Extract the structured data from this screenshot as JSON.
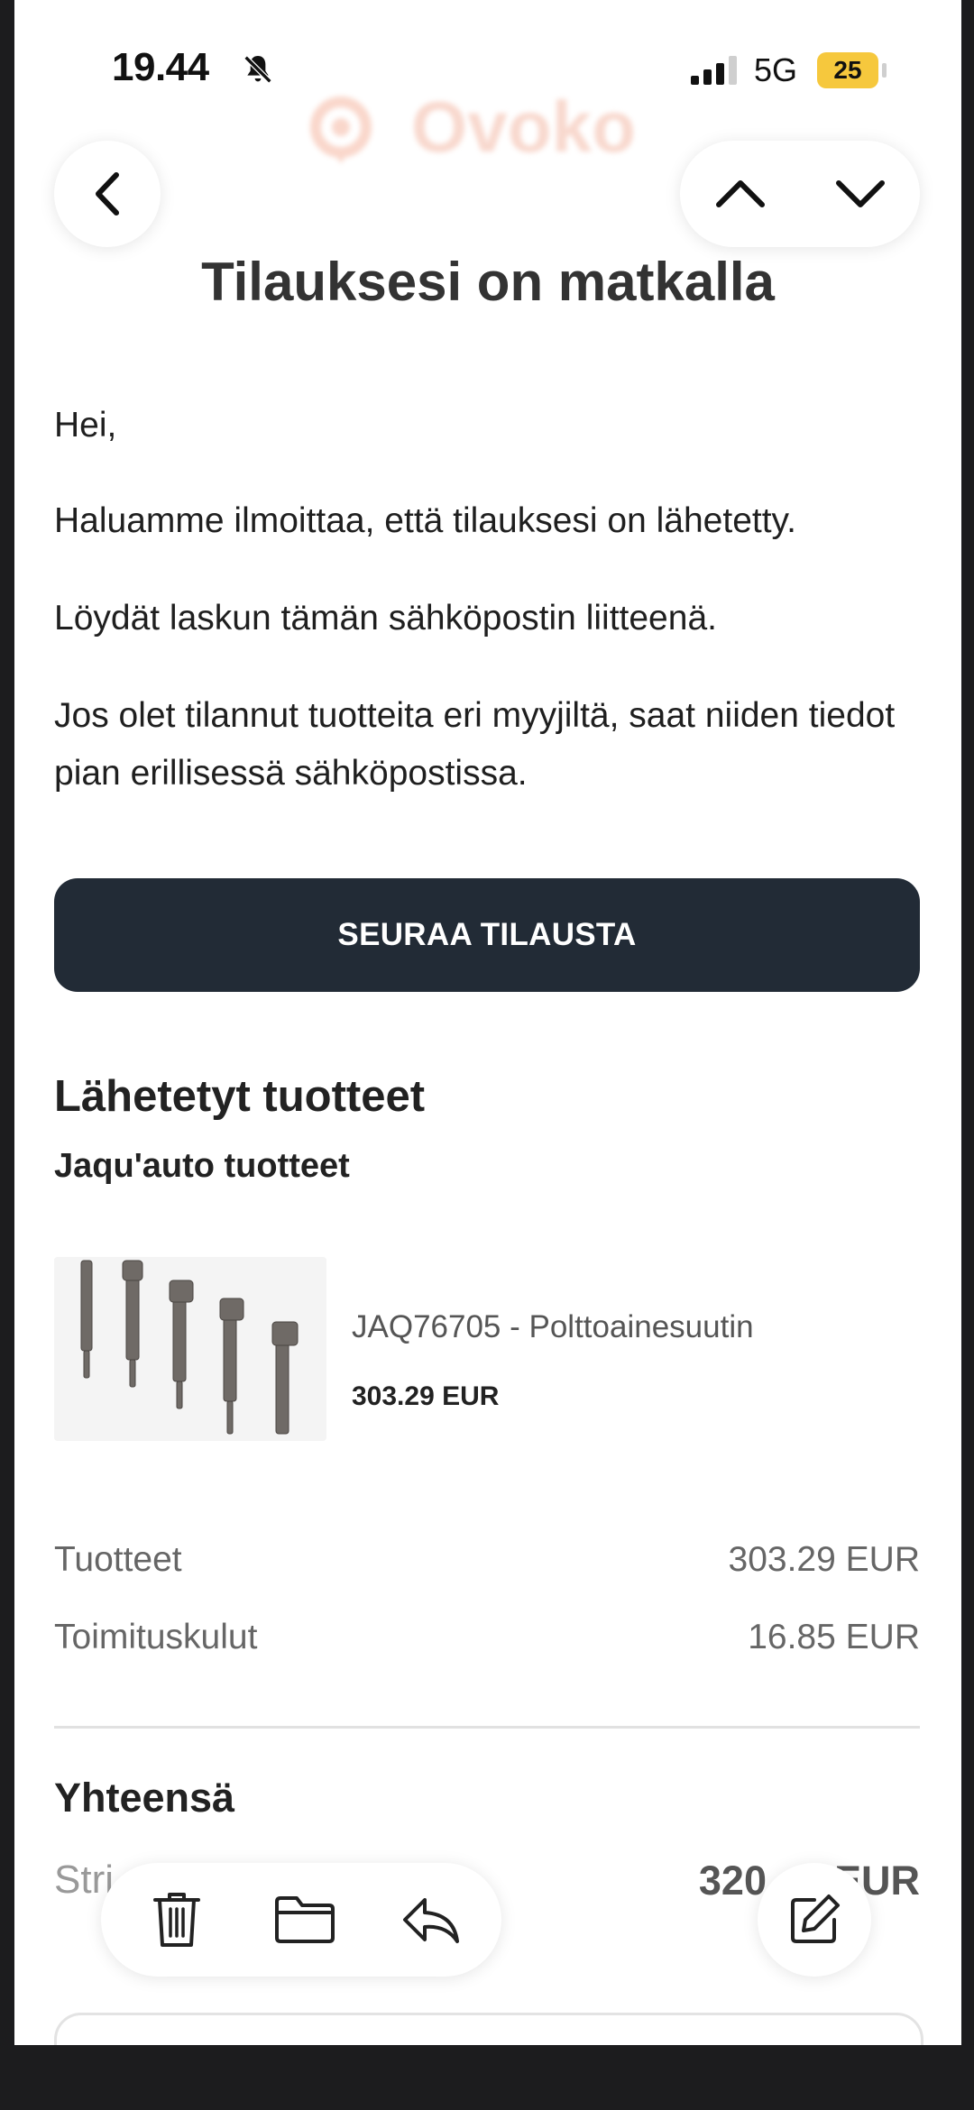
{
  "status_bar": {
    "time": "19.44",
    "network": "5G",
    "battery": "25"
  },
  "brand": {
    "logo_text": "Ovoko"
  },
  "email": {
    "title": "Tilauksesi on matkalla",
    "greeting": "Hei,",
    "paragraphs": [
      "Haluamme ilmoittaa, että tilauksesi on lähetetty.",
      "Löydät laskun tämän sähköpostin liitteenä.",
      "Jos olet tilannut tuotteita eri myyjiltä, saat niiden tiedot pian erillisessä sähköpostissa."
    ],
    "track_button": "SEURAA TILAUSTA",
    "shipped_heading": "Lähetetyt tuotteet",
    "seller_heading": "Jaqu'auto tuotteet",
    "product": {
      "name": "JAQ76705 - Polttoainesuutin",
      "price": "303.29 EUR"
    },
    "summary": {
      "products_label": "Tuotteet",
      "products_value": "303.29 EUR",
      "shipping_label": "Toimituskulut",
      "shipping_value": "16.85 EUR",
      "total_label": "Yhteensä",
      "sub_label": "Stri",
      "total_value": "320      EUR"
    }
  },
  "icons": {
    "back": "chevron-left-icon",
    "prev": "chevron-up-icon",
    "next": "chevron-down-icon",
    "delete": "trash-icon",
    "move": "folder-icon",
    "reply": "reply-icon",
    "compose": "compose-icon",
    "mute": "bell-slash-icon"
  },
  "colors": {
    "button_dark": "#222b36",
    "battery": "#f6c83d",
    "logo": "#f3b9a6"
  }
}
